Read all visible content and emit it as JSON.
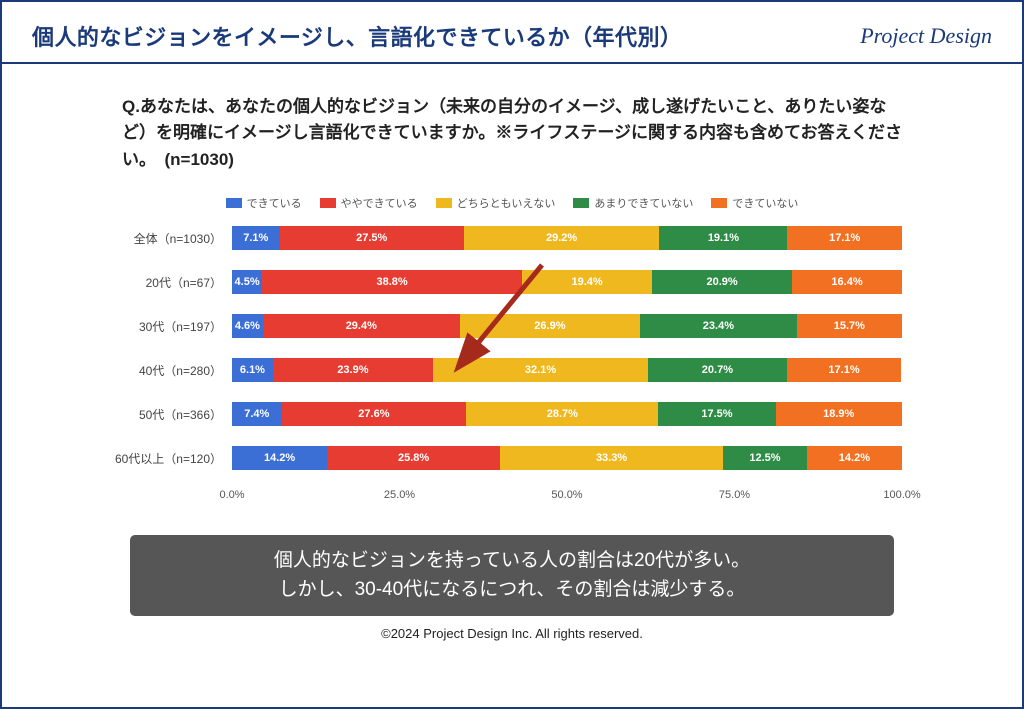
{
  "header": {
    "title": "個人的なビジョンをイメージし、言語化できているか（年代別）",
    "brand": "Project Design"
  },
  "question": "Q.あなたは、あなたの個人的なビジョン（未来の自分のイメージ、成し遂げたいこと、ありたい姿など）を明確にイメージし言語化できていますか。※ライフステージに関する内容も含めてお答えください。　(n=1030)",
  "chart_data": {
    "type": "bar",
    "stacked": true,
    "orientation": "horizontal",
    "xlabel": "",
    "ylabel": "",
    "xlim": [
      0,
      100
    ],
    "ticks": [
      "0.0%",
      "25.0%",
      "50.0%",
      "75.0%",
      "100.0%"
    ],
    "legend": [
      "できている",
      "ややできている",
      "どちらともいえない",
      "あまりできていない",
      "できていない"
    ],
    "colors": [
      "#3b6fd6",
      "#e63c32",
      "#f0b81f",
      "#2f8c46",
      "#f17022"
    ],
    "categories": [
      "全体（n=1030）",
      "20代（n=67）",
      "30代（n=197）",
      "40代（n=280）",
      "50代（n=366）",
      "60代以上（n=120）"
    ],
    "series": [
      {
        "name": "できている",
        "values": [
          7.1,
          4.5,
          4.6,
          6.1,
          7.4,
          14.2
        ]
      },
      {
        "name": "ややできている",
        "values": [
          27.5,
          38.8,
          29.4,
          23.9,
          27.6,
          25.8
        ]
      },
      {
        "name": "どちらともいえない",
        "values": [
          29.2,
          19.4,
          26.9,
          32.1,
          28.7,
          33.3
        ]
      },
      {
        "name": "あまりできていない",
        "values": [
          19.1,
          20.9,
          23.4,
          20.7,
          17.5,
          12.5
        ]
      },
      {
        "name": "できていない",
        "values": [
          17.1,
          16.4,
          15.7,
          17.1,
          18.9,
          14.2
        ]
      }
    ],
    "annotation_arrow": true
  },
  "summary": {
    "line1": "個人的なビジョンを持っている人の割合は20代が多い。",
    "line2": "しかし、30-40代になるにつれ、その割合は減少する。"
  },
  "copyright": "©2024 Project Design Inc.  All rights reserved."
}
